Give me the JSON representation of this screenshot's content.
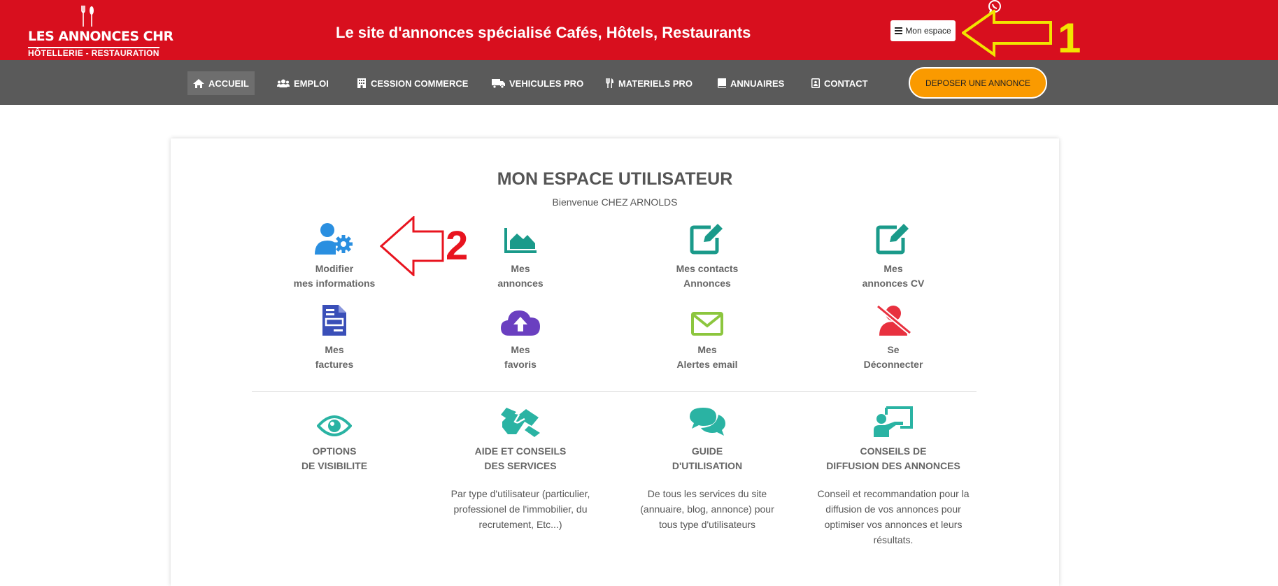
{
  "header": {
    "logo_text": "LES ANNONCES CHR",
    "logo_subtext": "HÔTELLERIE - RESTAURATION",
    "tagline": "Le site d'annonces spécialisé Cafés, Hôtels, Restaurants",
    "mon_espace_label": "Mon espace",
    "mon_espace_icon": "menu-icon",
    "whatsapp_icon": "whatsapp-icon"
  },
  "nav": {
    "items": [
      {
        "label": "ACCUEIL",
        "icon": "home-icon",
        "active": true
      },
      {
        "label": "EMPLOI",
        "icon": "users-icon"
      },
      {
        "label": "CESSION COMMERCE",
        "icon": "building-icon"
      },
      {
        "label": "VEHICULES PRO",
        "icon": "truck-icon"
      },
      {
        "label": "MATERIELS PRO",
        "icon": "cutlery-icon"
      },
      {
        "label": "ANNUAIRES",
        "icon": "book-icon"
      },
      {
        "label": "CONTACT",
        "icon": "contact-card-icon"
      }
    ],
    "cta_label": "DEPOSER UNE ANNONCE"
  },
  "main": {
    "title": "MON ESPACE UTILISATEUR",
    "welcome": "Bienvenue CHEZ ARNOLDS",
    "tiles": [
      {
        "line1": "Modifier",
        "line2": "mes informations",
        "icon": "user-cog-icon",
        "color": "#2a8fe0"
      },
      {
        "line1": "Mes",
        "line2": "annonces",
        "icon": "area-chart-icon",
        "color": "#1a9a8a"
      },
      {
        "line1": "Mes contacts",
        "line2": "Annonces",
        "icon": "edit-icon",
        "color": "#1a9a8a"
      },
      {
        "line1": "Mes",
        "line2": "annonces CV",
        "icon": "edit-icon",
        "color": "#1a9a8a"
      },
      {
        "line1": "Mes",
        "line2": "factures",
        "icon": "invoice-icon",
        "color": "#3a4fb8"
      },
      {
        "line1": "Mes",
        "line2": "favoris",
        "icon": "cloud-upload-icon",
        "color": "#6a3fc0"
      },
      {
        "line1": "Mes",
        "line2": "Alertes email",
        "icon": "envelope-icon",
        "color": "#8cc63e"
      },
      {
        "line1": "Se",
        "line2": "Déconnecter",
        "icon": "user-slash-icon",
        "color": "#e8313f"
      }
    ],
    "info_tiles": [
      {
        "line1": "OPTIONS",
        "line2": "DE VISIBILITE",
        "desc": "",
        "icon": "eye-icon"
      },
      {
        "line1": "AIDE ET CONSEILS",
        "line2": "DES SERVICES",
        "desc": "Par type d'utilisateur (particulier, professionel de l'immobilier, du recrutement, Etc...)",
        "icon": "handshake-icon"
      },
      {
        "line1": "GUIDE",
        "line2": "D'UTILISATION",
        "desc": "De tous les services du site (annuaire, blog, annonce) pour tous type d'utilisateurs",
        "icon": "comments-icon"
      },
      {
        "line1": "CONSEILS DE",
        "line2": "DIFFUSION DES ANNONCES",
        "desc": "Conseil et recommandation pour la diffusion de vos annonces pour optimiser vos annonces et leurs résultats.",
        "icon": "chalkboard-teacher-icon"
      }
    ],
    "info_color": "#2ab3a3"
  },
  "annotations": {
    "arrow1_number": "1",
    "arrow1_color": "#f2e400",
    "arrow2_number": "2",
    "arrow2_color": "#e8141f"
  }
}
